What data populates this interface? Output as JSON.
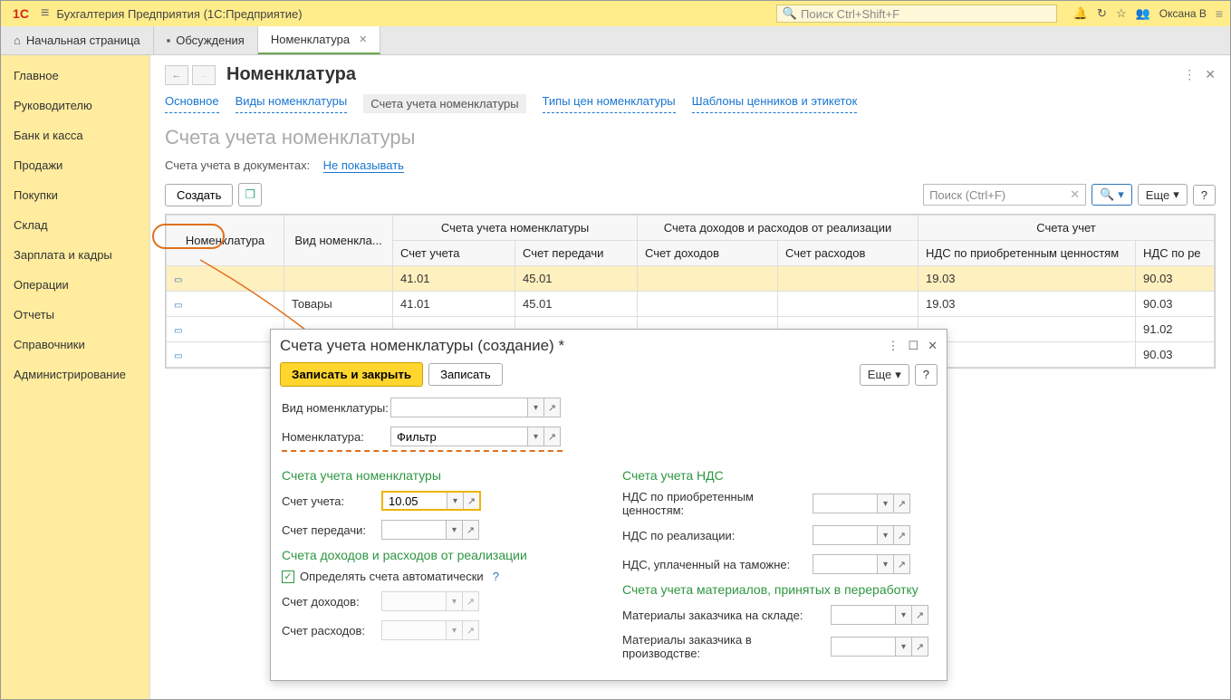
{
  "titlebar": {
    "logo": "1C",
    "title": "Бухгалтерия Предприятия  (1С:Предприятие)",
    "search_placeholder": "Поиск Ctrl+Shift+F",
    "username": "Оксана В"
  },
  "tabs": [
    {
      "icon": "⌂",
      "label": "Начальная страница"
    },
    {
      "icon": "💬",
      "label": "Обсуждения"
    },
    {
      "label": "Номенклатура",
      "active": true,
      "closable": true
    }
  ],
  "sidebar": {
    "items": [
      "Главное",
      "Руководителю",
      "Банк и касса",
      "Продажи",
      "Покупки",
      "Склад",
      "Зарплата и кадры",
      "Операции",
      "Отчеты",
      "Справочники",
      "Администрирование"
    ]
  },
  "page": {
    "title": "Номенклатура",
    "subnav": [
      "Основное",
      "Виды номенклатуры",
      "Счета учета номенклатуры",
      "Типы цен номенклатуры",
      "Шаблоны ценников и этикеток"
    ],
    "subnav_active": 2,
    "section_title": "Счета учета номенклатуры",
    "docs_label": "Счета учета в документах:",
    "docs_link": "Не показывать",
    "create_btn": "Создать",
    "search_placeholder": "Поиск (Ctrl+F)",
    "more_btn": "Еще",
    "help_btn": "?"
  },
  "table": {
    "group_headers": [
      "Номенклатура",
      "Вид номенкла...",
      "Счета учета номенклатуры",
      "Счета доходов и расходов от реализации",
      "Счета учет"
    ],
    "sub_headers": [
      "Счет учета",
      "Счет передачи",
      "Счет доходов",
      "Счет расходов",
      "НДС по приобретенным ценностям",
      "НДС по ре"
    ],
    "rows": [
      {
        "nom": "",
        "vid": "",
        "su": "41.01",
        "sp": "45.01",
        "sd": "",
        "sr": "",
        "nds_p": "19.03",
        "nds_r": "90.03",
        "sel": true
      },
      {
        "nom": "",
        "vid": "Товары",
        "su": "41.01",
        "sp": "45.01",
        "sd": "",
        "sr": "",
        "nds_p": "19.03",
        "nds_r": "90.03"
      },
      {
        "nom": "",
        "vid": "",
        "su": "",
        "sp": "",
        "sd": "",
        "sr": "",
        "nds_p": "",
        "nds_r": "91.02"
      },
      {
        "nom": "",
        "vid": "",
        "su": "",
        "sp": "",
        "sd": "",
        "sr": "",
        "nds_p": "",
        "nds_r": "90.03"
      }
    ]
  },
  "dialog": {
    "title": "Счета учета номенклатуры (создание) *",
    "save_close": "Записать и закрыть",
    "save": "Записать",
    "more": "Еще",
    "help": "?",
    "fields": {
      "vid_label": "Вид номенклатуры:",
      "nom_label": "Номенклатура:",
      "nom_value": "Фильтр",
      "grp1": "Счета учета номенклатуры",
      "schet_u_label": "Счет учета:",
      "schet_u_value": "10.05",
      "schet_p_label": "Счет передачи:",
      "grp2": "Счета доходов и расходов от реализации",
      "auto_label": "Определять счета автоматически",
      "schet_d_label": "Счет доходов:",
      "schet_r_label": "Счет расходов:",
      "grp3": "Счета учета НДС",
      "nds_pr_label": "НДС по приобретенным ценностям:",
      "nds_re_label": "НДС по реализации:",
      "nds_tam_label": "НДС, уплаченный на таможне:",
      "grp4": "Счета учета материалов, принятых в переработку",
      "mat_skl_label": "Материалы заказчика на складе:",
      "mat_pro_label": "Материалы заказчика в производстве:"
    }
  }
}
